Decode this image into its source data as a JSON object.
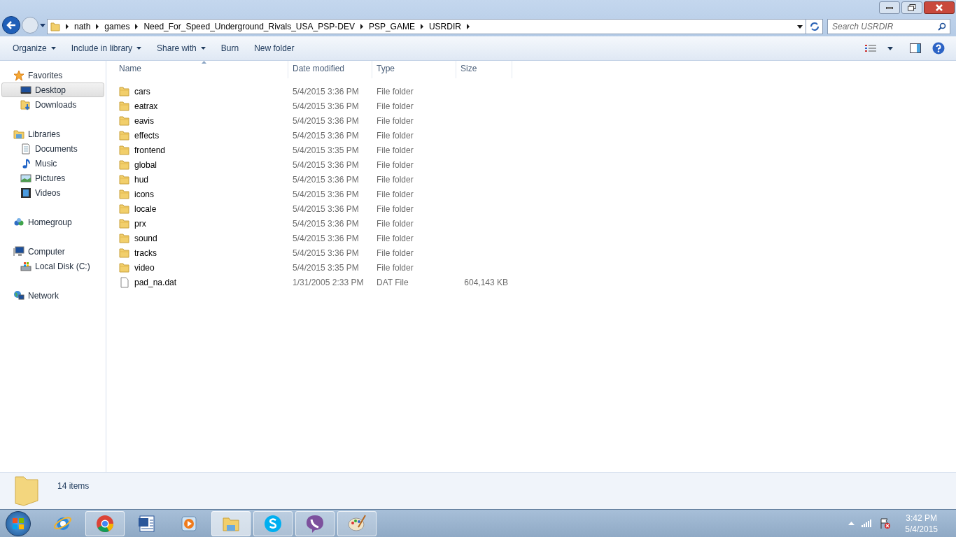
{
  "window": {
    "breadcrumbs": [
      "nath",
      "games",
      "Need_For_Speed_Underground_Rivals_USA_PSP-DEV",
      "PSP_GAME",
      "USRDIR"
    ],
    "search": {
      "placeholder": "Search USRDIR"
    }
  },
  "toolbar": [
    {
      "label": "Organize",
      "dropdown": true
    },
    {
      "label": "Include in library",
      "dropdown": true
    },
    {
      "label": "Share with",
      "dropdown": true
    },
    {
      "label": "Burn",
      "dropdown": false
    },
    {
      "label": "New folder",
      "dropdown": false
    }
  ],
  "sidebar": {
    "items": [
      {
        "label": "Favorites",
        "kind": "star",
        "selected": false,
        "children": [
          {
            "label": "Desktop",
            "kind": "desktop",
            "selected": true
          },
          {
            "label": "Downloads",
            "kind": "downloads",
            "selected": false
          }
        ]
      },
      {
        "label": "Libraries",
        "kind": "libraries",
        "selected": false,
        "children": [
          {
            "label": "Documents",
            "kind": "document",
            "selected": false
          },
          {
            "label": "Music",
            "kind": "music",
            "selected": false
          },
          {
            "label": "Pictures",
            "kind": "pictures",
            "selected": false
          },
          {
            "label": "Videos",
            "kind": "videos",
            "selected": false
          }
        ]
      },
      {
        "label": "Homegroup",
        "kind": "homegroup",
        "selected": false
      },
      {
        "label": "Computer",
        "kind": "computer",
        "selected": false,
        "children": [
          {
            "label": "Local Disk (C:)",
            "kind": "disk",
            "selected": false
          }
        ]
      },
      {
        "label": "Network",
        "kind": "network",
        "selected": false
      }
    ]
  },
  "table": {
    "columns": [
      "Name",
      "Date modified",
      "Type",
      "Size"
    ],
    "rows": [
      {
        "kind": "folder",
        "name": "cars",
        "date": "5/4/2015 3:36 PM",
        "type": "File folder"
      },
      {
        "kind": "folder",
        "name": "eatrax",
        "date": "5/4/2015 3:36 PM",
        "type": "File folder"
      },
      {
        "kind": "folder",
        "name": "eavis",
        "date": "5/4/2015 3:36 PM",
        "type": "File folder"
      },
      {
        "kind": "folder",
        "name": "effects",
        "date": "5/4/2015 3:36 PM",
        "type": "File folder"
      },
      {
        "kind": "folder",
        "name": "frontend",
        "date": "5/4/2015 3:35 PM",
        "type": "File folder"
      },
      {
        "kind": "folder",
        "name": "global",
        "date": "5/4/2015 3:36 PM",
        "type": "File folder"
      },
      {
        "kind": "folder",
        "name": "hud",
        "date": "5/4/2015 3:36 PM",
        "type": "File folder"
      },
      {
        "kind": "folder",
        "name": "icons",
        "date": "5/4/2015 3:36 PM",
        "type": "File folder"
      },
      {
        "kind": "folder",
        "name": "locale",
        "date": "5/4/2015 3:36 PM",
        "type": "File folder"
      },
      {
        "kind": "folder",
        "name": "prx",
        "date": "5/4/2015 3:36 PM",
        "type": "File folder"
      },
      {
        "kind": "folder",
        "name": "sound",
        "date": "5/4/2015 3:36 PM",
        "type": "File folder"
      },
      {
        "kind": "folder",
        "name": "tracks",
        "date": "5/4/2015 3:36 PM",
        "type": "File folder"
      },
      {
        "kind": "folder",
        "name": "video",
        "date": "5/4/2015 3:35 PM",
        "type": "File folder"
      },
      {
        "kind": "file",
        "name": "pad_na.dat",
        "date": "1/31/2005 2:33 PM",
        "type": "DAT File",
        "size": "604,143 KB"
      }
    ]
  },
  "status_bar": {
    "count": "14 items"
  },
  "taskbar": {
    "apps": [
      {
        "kind": "ie",
        "running": false,
        "selected": false
      },
      {
        "kind": "chrome",
        "running": true,
        "selected": false
      },
      {
        "kind": "word",
        "running": false,
        "selected": false
      },
      {
        "kind": "media",
        "running": false,
        "selected": false
      },
      {
        "kind": "explorer",
        "running": true,
        "selected": true
      },
      {
        "kind": "skype",
        "running": true,
        "selected": false
      },
      {
        "kind": "viber",
        "running": true,
        "selected": false
      },
      {
        "kind": "paint",
        "running": true,
        "selected": false
      }
    ],
    "time": "3:42 PM",
    "date": "5/4/2015"
  }
}
